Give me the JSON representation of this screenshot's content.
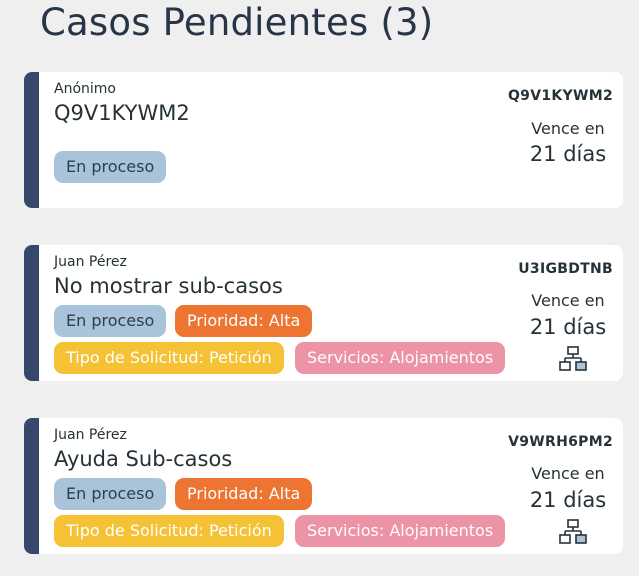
{
  "header": {
    "title": "Casos Pendientes (3)"
  },
  "colors": {
    "accent_bar": "#35486b",
    "status_tag": "#a9c4da",
    "priority_tag": "#ee7431",
    "request_type_tag": "#f4c234",
    "service_tag": "#ec93a6"
  },
  "cases": [
    {
      "requester": "Anónimo",
      "title": "Q9V1KYWM2",
      "code": "Q9V1KYWM2",
      "due_label": "Vence en",
      "due_value": "21 días",
      "status": "En proceso"
    },
    {
      "requester": "Juan Pérez",
      "title": "No mostrar sub-casos",
      "code": "U3IGBDTNB",
      "due_label": "Vence en",
      "due_value": "21 días",
      "status": "En proceso",
      "priority": "Prioridad: Alta",
      "request_type": "Tipo de Solicitud: Petición",
      "service": "Servicios: Alojamientos",
      "subcases_icon": "hierarchy-icon"
    },
    {
      "requester": "Juan Pérez",
      "title": "Ayuda Sub-casos",
      "code": "V9WRH6PM2",
      "due_label": "Vence en",
      "due_value": "21 días",
      "status": "En proceso",
      "priority": "Prioridad: Alta",
      "request_type": "Tipo de Solicitud: Petición",
      "service": "Servicios: Alojamientos",
      "subcases_icon": "hierarchy-icon"
    }
  ]
}
